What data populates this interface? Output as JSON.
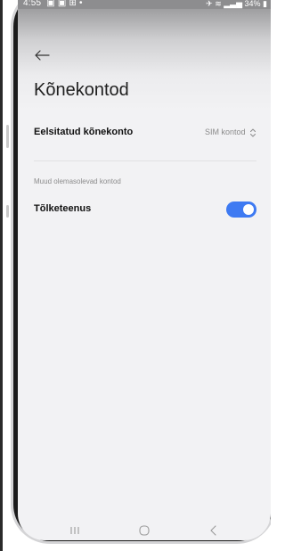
{
  "status_bar": {
    "time": "4:55",
    "battery_percent": "34%"
  },
  "header": {
    "title": "Kõnekontod"
  },
  "default_account": {
    "label": "Eelsitatud kõnekonto",
    "value": "SIM kontod"
  },
  "other_accounts": {
    "section_label": "Muud olemasolevad kontod",
    "items": [
      {
        "label": "Tõlketeenus",
        "enabled": true
      }
    ]
  },
  "colors": {
    "toggle_on": "#3e7af2",
    "header_top": "#9e9ea0",
    "screen_bg": "#f2f2f4"
  },
  "icons": {
    "back": "arrow-left-icon",
    "select": "unfold-icon",
    "nav_recents": "recents-icon",
    "nav_home": "home-icon",
    "nav_back": "back-icon"
  }
}
